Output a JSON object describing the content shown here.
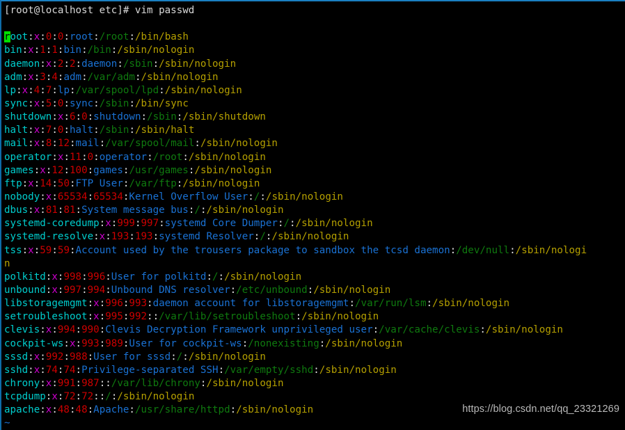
{
  "terminal": {
    "window_title": "vim passwd",
    "background_color": "#000000",
    "border_color": "#1a7fc1",
    "prompt_line": "[root@localhost etc]# vim passwd",
    "blank_line": "",
    "empty_line_marker": "~",
    "cursor": {
      "char": "r",
      "row": 2,
      "column": 0,
      "color": "#00e000"
    }
  },
  "colors": {
    "username": "#00cdcd",
    "password": "#cd00cd",
    "uid_gid": "#cd0000",
    "gecos": "#1a72d4",
    "home": "#0f7a0f",
    "shell": "#b5a000",
    "separator": "#e6e6e6",
    "tilde": "#1a72d4",
    "prompt": "#d8d8d8"
  },
  "file": {
    "name": "passwd",
    "path": "/etc/passwd",
    "entries": [
      {
        "user": "root",
        "pw": "x",
        "uid": "0",
        "gid": "0",
        "gecos": "root",
        "home": "/root",
        "shell": "/bin/bash"
      },
      {
        "user": "bin",
        "pw": "x",
        "uid": "1",
        "gid": "1",
        "gecos": "bin",
        "home": "/bin",
        "shell": "/sbin/nologin"
      },
      {
        "user": "daemon",
        "pw": "x",
        "uid": "2",
        "gid": "2",
        "gecos": "daemon",
        "home": "/sbin",
        "shell": "/sbin/nologin"
      },
      {
        "user": "adm",
        "pw": "x",
        "uid": "3",
        "gid": "4",
        "gecos": "adm",
        "home": "/var/adm",
        "shell": "/sbin/nologin"
      },
      {
        "user": "lp",
        "pw": "x",
        "uid": "4",
        "gid": "7",
        "gecos": "lp",
        "home": "/var/spool/lpd",
        "shell": "/sbin/nologin"
      },
      {
        "user": "sync",
        "pw": "x",
        "uid": "5",
        "gid": "0",
        "gecos": "sync",
        "home": "/sbin",
        "shell": "/bin/sync"
      },
      {
        "user": "shutdown",
        "pw": "x",
        "uid": "6",
        "gid": "0",
        "gecos": "shutdown",
        "home": "/sbin",
        "shell": "/sbin/shutdown"
      },
      {
        "user": "halt",
        "pw": "x",
        "uid": "7",
        "gid": "0",
        "gecos": "halt",
        "home": "/sbin",
        "shell": "/sbin/halt"
      },
      {
        "user": "mail",
        "pw": "x",
        "uid": "8",
        "gid": "12",
        "gecos": "mail",
        "home": "/var/spool/mail",
        "shell": "/sbin/nologin"
      },
      {
        "user": "operator",
        "pw": "x",
        "uid": "11",
        "gid": "0",
        "gecos": "operator",
        "home": "/root",
        "shell": "/sbin/nologin"
      },
      {
        "user": "games",
        "pw": "x",
        "uid": "12",
        "gid": "100",
        "gecos": "games",
        "home": "/usr/games",
        "shell": "/sbin/nologin"
      },
      {
        "user": "ftp",
        "pw": "x",
        "uid": "14",
        "gid": "50",
        "gecos": "FTP User",
        "home": "/var/ftp",
        "shell": "/sbin/nologin"
      },
      {
        "user": "nobody",
        "pw": "x",
        "uid": "65534",
        "gid": "65534",
        "gecos": "Kernel Overflow User",
        "home": "/",
        "shell": "/sbin/nologin"
      },
      {
        "user": "dbus",
        "pw": "x",
        "uid": "81",
        "gid": "81",
        "gecos": "System message bus",
        "home": "/",
        "shell": "/sbin/nologin"
      },
      {
        "user": "systemd-coredump",
        "pw": "x",
        "uid": "999",
        "gid": "997",
        "gecos": "systemd Core Dumper",
        "home": "/",
        "shell": "/sbin/nologin"
      },
      {
        "user": "systemd-resolve",
        "pw": "x",
        "uid": "193",
        "gid": "193",
        "gecos": "systemd Resolver",
        "home": "/",
        "shell": "/sbin/nologin"
      },
      {
        "user": "tss",
        "pw": "x",
        "uid": "59",
        "gid": "59",
        "gecos": "Account used by the trousers package to sandbox the tcsd daemon",
        "home": "/dev/null",
        "shell": "/sbin/nologin"
      },
      {
        "user": "polkitd",
        "pw": "x",
        "uid": "998",
        "gid": "996",
        "gecos": "User for polkitd",
        "home": "/",
        "shell": "/sbin/nologin"
      },
      {
        "user": "unbound",
        "pw": "x",
        "uid": "997",
        "gid": "994",
        "gecos": "Unbound DNS resolver",
        "home": "/etc/unbound",
        "shell": "/sbin/nologin"
      },
      {
        "user": "libstoragemgmt",
        "pw": "x",
        "uid": "996",
        "gid": "993",
        "gecos": "daemon account for libstoragemgmt",
        "home": "/var/run/lsm",
        "shell": "/sbin/nologin"
      },
      {
        "user": "setroubleshoot",
        "pw": "x",
        "uid": "995",
        "gid": "992",
        "gecos": "",
        "home": "/var/lib/setroubleshoot",
        "shell": "/sbin/nologin"
      },
      {
        "user": "clevis",
        "pw": "x",
        "uid": "994",
        "gid": "990",
        "gecos": "Clevis Decryption Framework unprivileged user",
        "home": "/var/cache/clevis",
        "shell": "/sbin/nologin"
      },
      {
        "user": "cockpit-ws",
        "pw": "x",
        "uid": "993",
        "gid": "989",
        "gecos": "User for cockpit-ws",
        "home": "/nonexisting",
        "shell": "/sbin/nologin"
      },
      {
        "user": "sssd",
        "pw": "x",
        "uid": "992",
        "gid": "988",
        "gecos": "User for sssd",
        "home": "/",
        "shell": "/sbin/nologin"
      },
      {
        "user": "sshd",
        "pw": "x",
        "uid": "74",
        "gid": "74",
        "gecos": "Privilege-separated SSH",
        "home": "/var/empty/sshd",
        "shell": "/sbin/nologin"
      },
      {
        "user": "chrony",
        "pw": "x",
        "uid": "991",
        "gid": "987",
        "gecos": "",
        "home": "/var/lib/chrony",
        "shell": "/sbin/nologin"
      },
      {
        "user": "tcpdump",
        "pw": "x",
        "uid": "72",
        "gid": "72",
        "gecos": "",
        "home": "/",
        "shell": "/sbin/nologin"
      },
      {
        "user": "apache",
        "pw": "x",
        "uid": "48",
        "gid": "48",
        "gecos": "Apache",
        "home": "/usr/share/httpd",
        "shell": "/sbin/nologin"
      }
    ]
  },
  "watermark": {
    "text": "https://blog.csdn.net/qq_23321269"
  }
}
